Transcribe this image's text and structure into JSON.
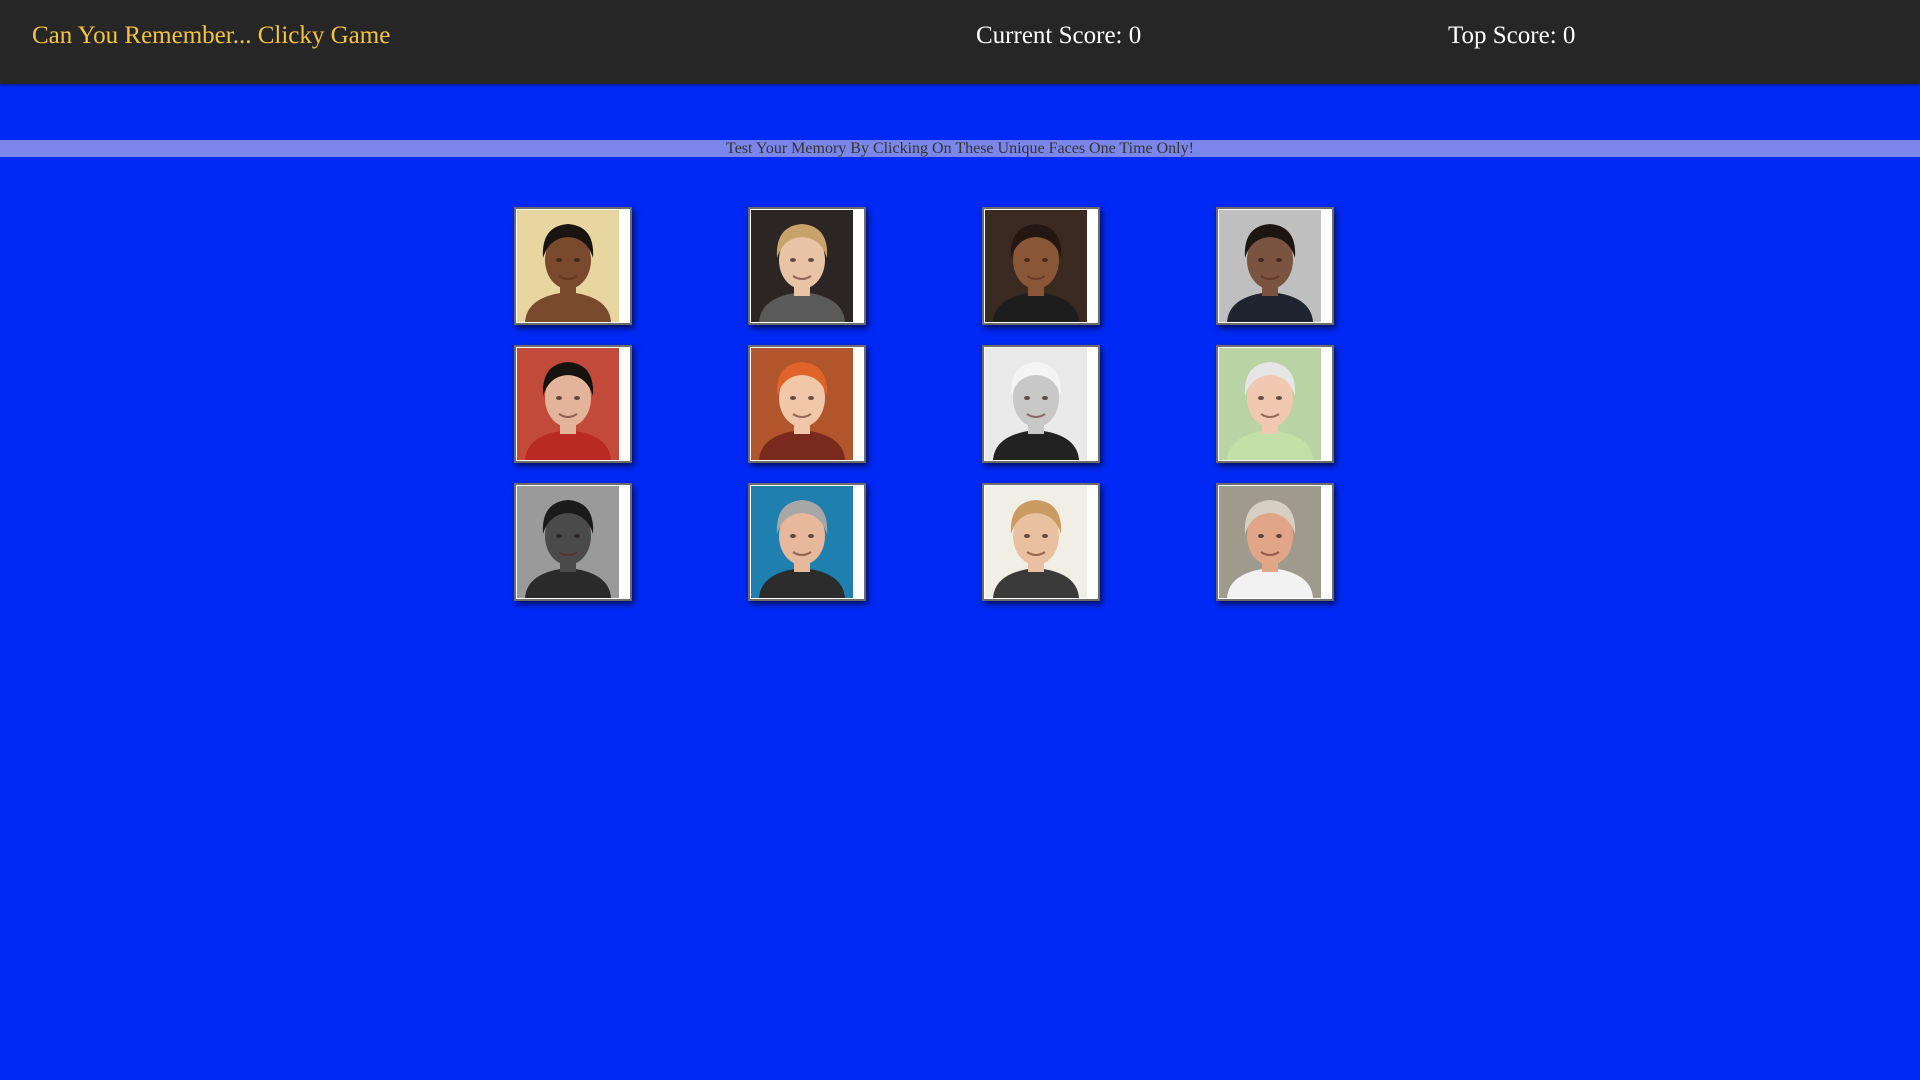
{
  "navbar": {
    "brand": "Can You Remember... Clicky Game",
    "current_score_label": "Current Score: 0",
    "top_score_label": "Top Score: 0"
  },
  "banner": {
    "text": "Test Your Memory By Clicking On These Unique Faces One Time Only!"
  },
  "colors": {
    "background": "#0029f5",
    "navbar": "#262626",
    "brand": "#f5c33d",
    "banner": "#7b86ea"
  },
  "cards": [
    {
      "name": "face-card-1",
      "palette": {
        "bg": "#e8d6a0",
        "skin": "#7a4a2e",
        "hair": "#1a1410",
        "shirt": "#7a4a2e"
      }
    },
    {
      "name": "face-card-2",
      "palette": {
        "bg": "#2b2623",
        "skin": "#e9c3a6",
        "hair": "#c7a36a",
        "shirt": "#5a5a5a"
      }
    },
    {
      "name": "face-card-3",
      "palette": {
        "bg": "#3a2a22",
        "skin": "#8a5638",
        "hair": "#241711",
        "shirt": "#1d1d1d"
      }
    },
    {
      "name": "face-card-4",
      "palette": {
        "bg": "#bfbfbf",
        "skin": "#7a5440",
        "hair": "#1c1612",
        "shirt": "#1e2530"
      }
    },
    {
      "name": "face-card-5",
      "palette": {
        "bg": "#c24a3a",
        "skin": "#e4b49a",
        "hair": "#16120f",
        "shirt": "#b82a22"
      }
    },
    {
      "name": "face-card-6",
      "palette": {
        "bg": "#b0552c",
        "skin": "#f0c7a8",
        "hair": "#e0632a",
        "shirt": "#7a2a1c"
      }
    },
    {
      "name": "face-card-7",
      "palette": {
        "bg": "#e9e9e9",
        "skin": "#c8c8c8",
        "hair": "#f4f4f4",
        "shirt": "#222222"
      }
    },
    {
      "name": "face-card-8",
      "palette": {
        "bg": "#b9d3a5",
        "skin": "#f0c9b0",
        "hair": "#e6e6e6",
        "shirt": "#c2e0a8"
      }
    },
    {
      "name": "face-card-9",
      "palette": {
        "bg": "#9a9a9a",
        "skin": "#4a4a4a",
        "hair": "#1a1a1a",
        "shirt": "#2a2a2a"
      }
    },
    {
      "name": "face-card-10",
      "palette": {
        "bg": "#1f7fae",
        "skin": "#e7b89b",
        "hair": "#a7a7a7",
        "shirt": "#2c2c2c"
      }
    },
    {
      "name": "face-card-11",
      "palette": {
        "bg": "#f1eee6",
        "skin": "#e9c0a0",
        "hair": "#c99b63",
        "shirt": "#3a3a3a"
      }
    },
    {
      "name": "face-card-12",
      "palette": {
        "bg": "#9e9a8e",
        "skin": "#e1a688",
        "hair": "#d8cfc4",
        "shirt": "#f2f2f2"
      }
    }
  ]
}
